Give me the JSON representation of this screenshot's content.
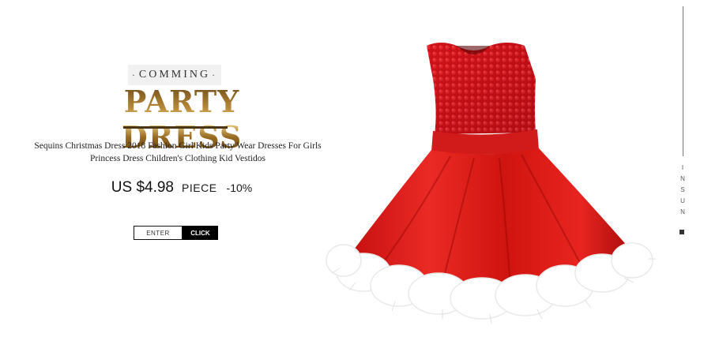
{
  "promo": {
    "coming_label": "COMMING",
    "coming_dot_left": "·",
    "coming_dot_right": "·",
    "title": "PARTY DRESS",
    "description": "Sequins Christmas Dress 2018 Fashion Girl Kids Party Wear Dresses For Girls Princess Dress Children's Clothing Kid Vestidos",
    "price": "US $4.98",
    "unit": "PIECE",
    "discount": "-10%",
    "enter_label": "ENTER",
    "click_label": "CLICK"
  },
  "side": {
    "brand_letters": [
      "I",
      "N",
      "S",
      "U",
      "N"
    ]
  },
  "colors": {
    "title_gold": "#b98a3a",
    "dress_red": "#d01010",
    "button_dark": "#000000"
  },
  "images": {
    "product": "red-sequin-party-dress-with-white-fur-trim"
  }
}
